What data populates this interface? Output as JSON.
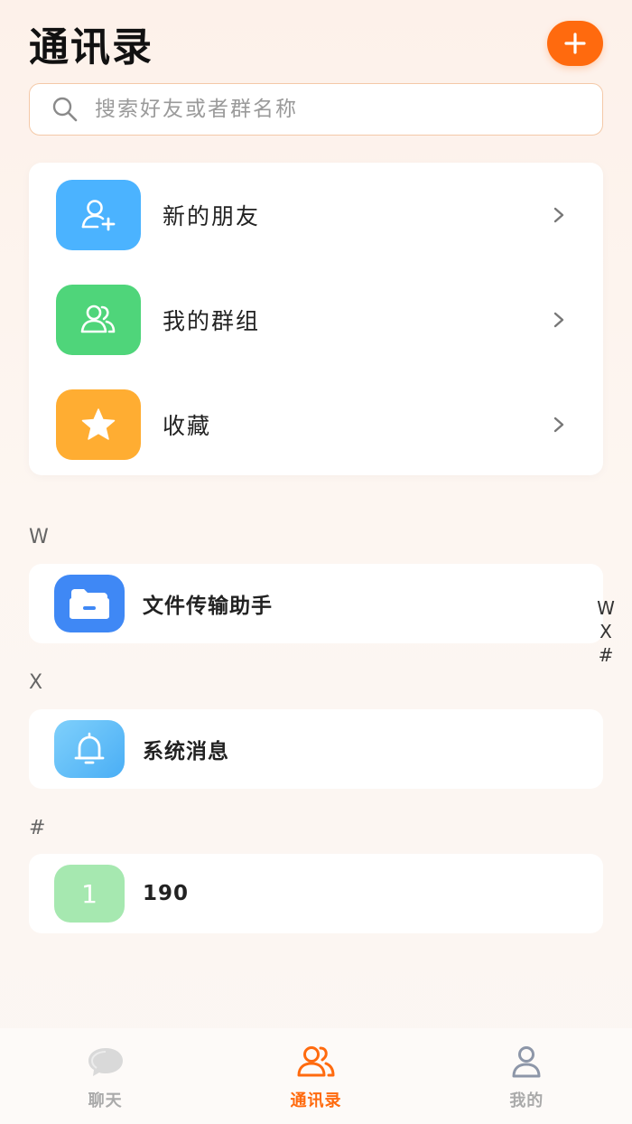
{
  "header": {
    "title": "通讯录"
  },
  "search": {
    "placeholder": "搜索好友或者群名称"
  },
  "menu": {
    "items": [
      {
        "label": "新的朋友",
        "icon": "add-user-icon",
        "color": "#4bb3ff"
      },
      {
        "label": "我的群组",
        "icon": "group-icon",
        "color": "#4fd57a"
      },
      {
        "label": "收藏",
        "icon": "star-icon",
        "color": "#ffad32"
      }
    ]
  },
  "sections": [
    {
      "letter": "W",
      "contacts": [
        {
          "name": "文件传输助手",
          "icon": "folder-icon",
          "color": "#3f88f5"
        }
      ]
    },
    {
      "letter": "X",
      "contacts": [
        {
          "name": "系统消息",
          "icon": "bell-icon",
          "color": "#62c0f8"
        }
      ]
    },
    {
      "letter": "#",
      "contacts": [
        {
          "name": "190",
          "avatar_text": "1",
          "color": "#a6e8b0"
        }
      ]
    }
  ],
  "index_bar": [
    "W",
    "X",
    "#"
  ],
  "tabbar": {
    "tabs": [
      {
        "label": "聊天",
        "icon": "chat-icon",
        "active": false
      },
      {
        "label": "通讯录",
        "icon": "contacts-icon",
        "active": true
      },
      {
        "label": "我的",
        "icon": "profile-icon",
        "active": false
      }
    ]
  },
  "colors": {
    "accent": "#ff6a0e",
    "search_border": "#f4c9a8"
  }
}
